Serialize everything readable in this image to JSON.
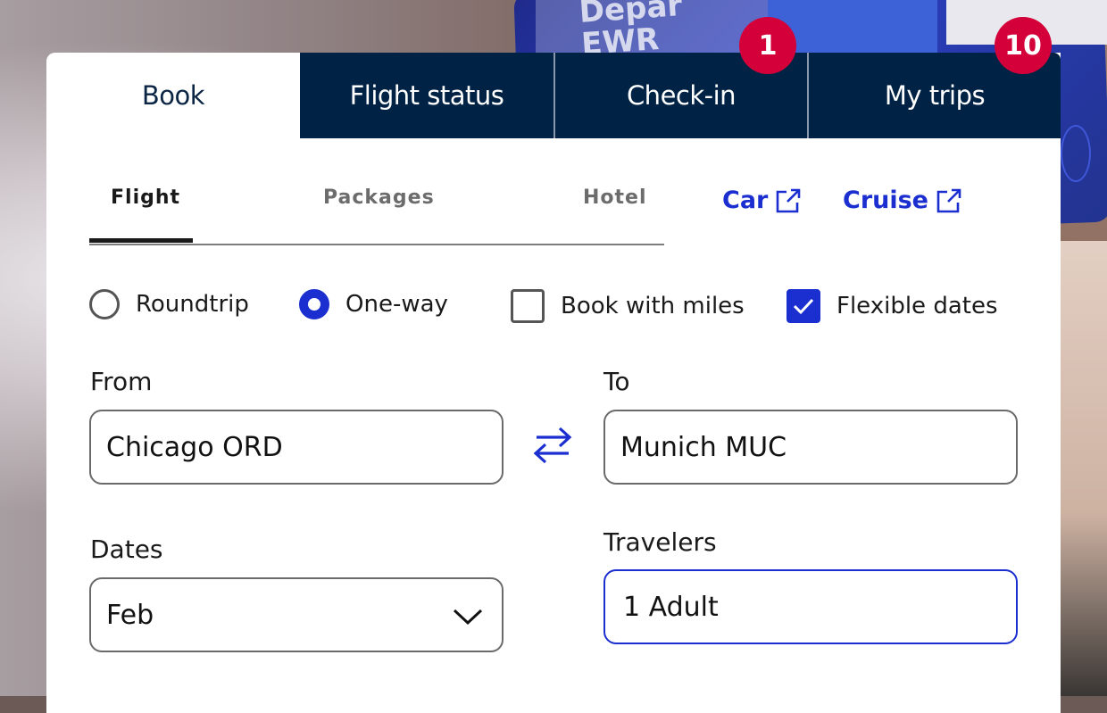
{
  "background": {
    "screen_text": "Depar\nEWR"
  },
  "tabs": [
    {
      "label": "Book",
      "active": true
    },
    {
      "label": "Flight status",
      "active": false
    },
    {
      "label": "Check-in",
      "active": false,
      "badge": "1"
    },
    {
      "label": "My trips",
      "active": false,
      "badge": "10"
    }
  ],
  "subtabs": {
    "flight": "Flight",
    "packages": "Packages",
    "hotel": "Hotel",
    "active": "Flight"
  },
  "external_links": {
    "car": "Car",
    "cruise": "Cruise",
    "icon": "external-link-icon"
  },
  "options": {
    "roundtrip": {
      "label": "Roundtrip",
      "selected": false
    },
    "oneway": {
      "label": "One-way",
      "selected": true
    },
    "book_with_miles": {
      "label": "Book with miles",
      "checked": false
    },
    "flexible_dates": {
      "label": "Flexible dates",
      "checked": true
    }
  },
  "fields": {
    "from": {
      "label": "From",
      "value": "Chicago ORD"
    },
    "to": {
      "label": "To",
      "value": "Munich MUC"
    },
    "dates": {
      "label": "Dates",
      "value": "Feb"
    },
    "travelers": {
      "label": "Travelers",
      "value": "1 Adult"
    }
  },
  "colors": {
    "navy": "#002244",
    "accent_blue": "#1b2fd1",
    "badge_red": "#d3003a"
  }
}
